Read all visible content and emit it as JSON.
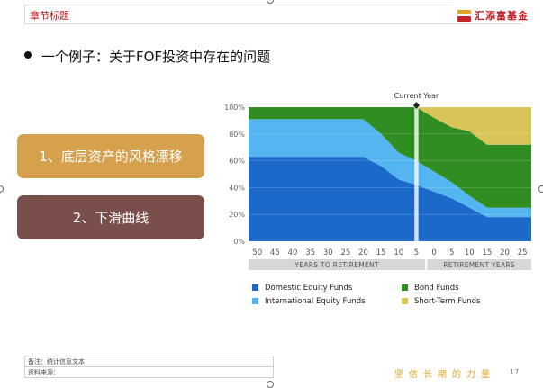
{
  "header": {
    "title": "章节标题",
    "logo_text": "汇添富基金"
  },
  "bullet": {
    "text": "一个例子：关于FOF投资中存在的问题"
  },
  "buttons": [
    {
      "label": "1、底层资产的风格漂移"
    },
    {
      "label": "2、下滑曲线"
    }
  ],
  "chart_data": {
    "type": "area",
    "stacked": true,
    "x": [
      50,
      45,
      40,
      35,
      30,
      25,
      20,
      15,
      10,
      5,
      0,
      5,
      10,
      15,
      20,
      25
    ],
    "x_tick_labels": [
      "50",
      "45",
      "40",
      "35",
      "30",
      "25",
      "20",
      "15",
      "10",
      "5",
      "0",
      "5",
      "10",
      "15",
      "20",
      "25"
    ],
    "y_tick_labels": [
      "0%",
      "20%",
      "40%",
      "60%",
      "80%",
      "100%"
    ],
    "ylim": [
      0,
      100
    ],
    "x_groups": [
      {
        "label": "YEARS TO RETIREMENT"
      },
      {
        "label": "RETIREMENT YEARS"
      }
    ],
    "annotation": {
      "label": "Current Year",
      "x_index": 9
    },
    "series": [
      {
        "name": "Domestic Equity Funds",
        "color": "#1c69c9",
        "values": [
          63,
          63,
          63,
          63,
          63,
          63,
          63,
          56,
          46,
          42,
          37,
          32,
          25,
          18,
          18,
          18
        ]
      },
      {
        "name": "International Equity Funds",
        "color": "#53b6f0",
        "values": [
          28,
          28,
          28,
          28,
          28,
          28,
          28,
          24,
          20,
          18,
          15,
          12,
          9,
          7,
          7,
          7
        ]
      },
      {
        "name": "Bond Funds",
        "color": "#2f8d22",
        "values": [
          9,
          9,
          9,
          9,
          9,
          9,
          9,
          20,
          34,
          40,
          40,
          41,
          48,
          47,
          47,
          47
        ]
      },
      {
        "name": "Short-Term Funds",
        "color": "#d9c458",
        "values": [
          0,
          0,
          0,
          0,
          0,
          0,
          0,
          0,
          0,
          0,
          8,
          15,
          18,
          28,
          28,
          28
        ]
      }
    ]
  },
  "footer": {
    "note": "备注：统计信息文本",
    "source": "资料来源：",
    "slogan": "坚信长期的力量",
    "page_number": "17"
  }
}
